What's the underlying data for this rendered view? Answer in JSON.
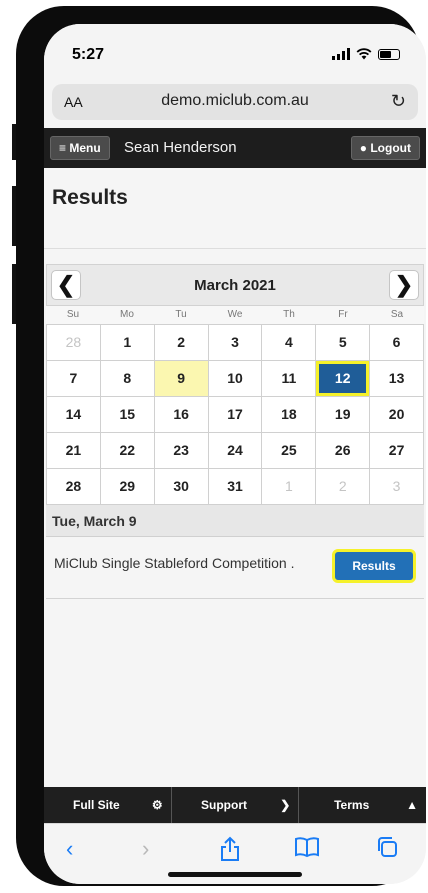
{
  "status_bar": {
    "time": "5:27"
  },
  "browser": {
    "text_size_label": "AA",
    "url": "demo.miclub.com.au"
  },
  "nav": {
    "menu_label": "≡ Menu",
    "user_name": "Sean Henderson",
    "logout_label": "Logout"
  },
  "page": {
    "title": "Results"
  },
  "calendar": {
    "month_label": "March 2021",
    "weekdays": [
      "Su",
      "Mo",
      "Tu",
      "We",
      "Th",
      "Fr",
      "Sa"
    ],
    "highlighted_day": "9",
    "selected_day": "12",
    "weeks": [
      [
        "28",
        "1",
        "2",
        "3",
        "4",
        "5",
        "6"
      ],
      [
        "7",
        "8",
        "9",
        "10",
        "11",
        "12",
        "13"
      ],
      [
        "14",
        "15",
        "16",
        "17",
        "18",
        "19",
        "20"
      ],
      [
        "21",
        "22",
        "23",
        "24",
        "25",
        "26",
        "27"
      ],
      [
        "28",
        "29",
        "30",
        "31",
        "1",
        "2",
        "3"
      ]
    ]
  },
  "selected_date": "Tue, March 9",
  "event": {
    "name": "MiClub Single Stableford Competition .",
    "button_label": "Results"
  },
  "footer": {
    "full_site": "Full Site",
    "support": "Support",
    "terms": "Terms"
  },
  "colors": {
    "nav_bg": "#1d1d1d",
    "accent_blue": "#2270b7",
    "highlight_yellow": "#f5f12a",
    "today_bg": "#fbf7b0"
  },
  "icons": {
    "prev": "chevron-left-icon",
    "next": "chevron-right-icon",
    "logout": "circle-icon",
    "full_site": "gear-icon",
    "support": "chevron-right-icon",
    "terms": "warning-icon"
  }
}
